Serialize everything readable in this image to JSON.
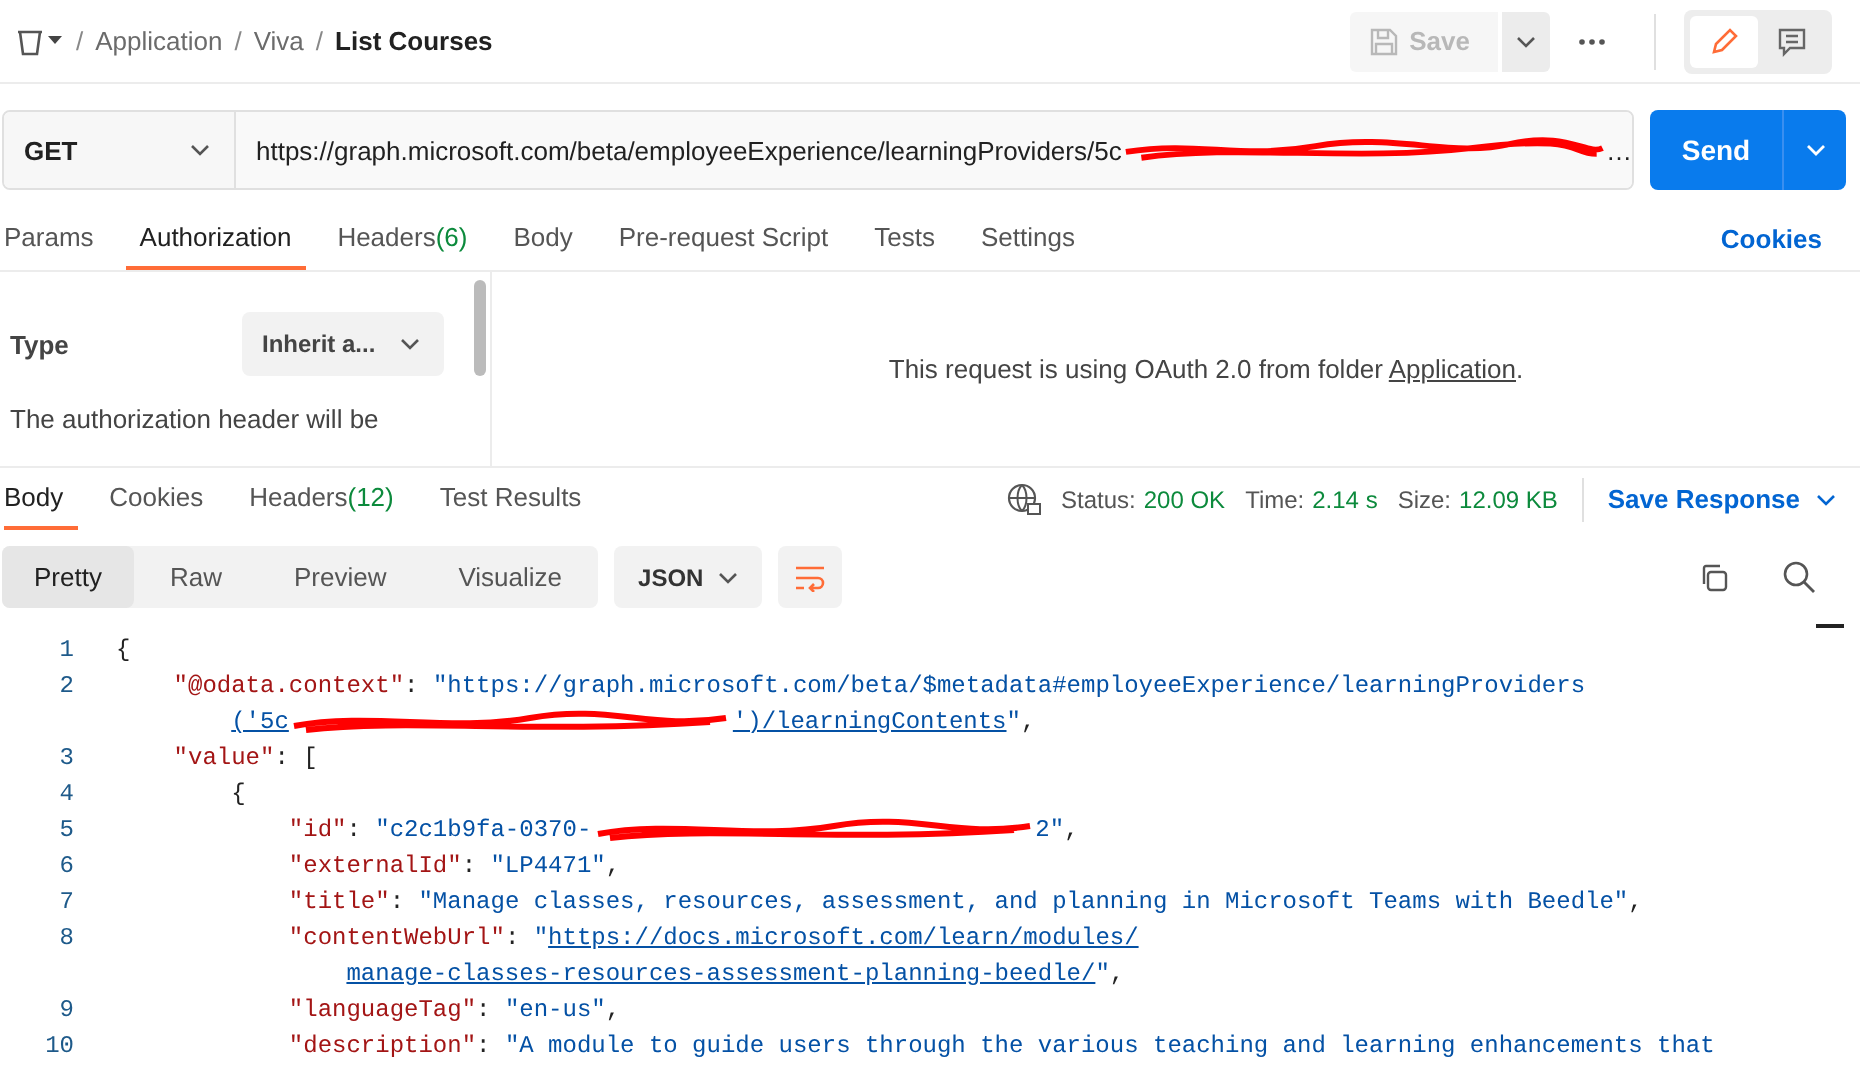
{
  "header": {
    "path": [
      {
        "separator": "/",
        "label": "Application"
      },
      {
        "separator": "/",
        "label": "Viva"
      }
    ],
    "title_separator": "/",
    "title": "List Courses",
    "save_button": {
      "label": "Save",
      "disabled": true
    }
  },
  "request": {
    "method": "GET",
    "url": "https://graph.microsoft.com/beta/employeeExperience/learningProviders/5c",
    "url_tail": "…",
    "send": "Send"
  },
  "request_tabs": [
    {
      "label": "Params",
      "selected": false
    },
    {
      "label": "Authorization",
      "selected": true
    },
    {
      "label": "Headers",
      "count": "(6)",
      "selected": false
    },
    {
      "label": "Body",
      "selected": false
    },
    {
      "label": "Pre-request Script",
      "selected": false
    },
    {
      "label": "Tests",
      "selected": false
    },
    {
      "label": "Settings",
      "selected": false
    }
  ],
  "cookies_link": "Cookies",
  "auth": {
    "type_label": "Type",
    "type_value": "Inherit a...",
    "description": "The authorization header will be",
    "message_before": "This request is using OAuth 2.0 from folder ",
    "message_link": "Application",
    "message_after": "."
  },
  "response_tabs": [
    {
      "label": "Body",
      "selected": true
    },
    {
      "label": "Cookies",
      "selected": false
    },
    {
      "label": "Headers",
      "count": "(12)",
      "selected": false
    },
    {
      "label": "Test Results",
      "selected": false
    }
  ],
  "status": [
    {
      "label": "Status:",
      "value": "200 OK"
    },
    {
      "label": "Time:",
      "value": "2.14 s"
    },
    {
      "label": "Size:",
      "value": "12.09 KB"
    }
  ],
  "save_response": "Save Response",
  "view_tabs": [
    {
      "label": "Pretty",
      "selected": true
    },
    {
      "label": "Raw",
      "selected": false
    },
    {
      "label": "Preview",
      "selected": false
    },
    {
      "label": "Visualize",
      "selected": false
    }
  ],
  "format": "JSON",
  "code": [
    {
      "number": "1",
      "parts": [
        {
          "kind": "punct",
          "text": "{"
        }
      ]
    },
    {
      "number": "2",
      "parts": [
        {
          "kind": "key",
          "text": "    \"@odata.context\""
        },
        {
          "kind": "punct",
          "text": ": "
        },
        {
          "kind": "string",
          "text": "\"https://graph.microsoft.com/beta/$metadata#employeeExperience/learningProviders"
        }
      ]
    },
    {
      "parts": [
        {
          "kind": "link",
          "text": "('5c"
        },
        {
          "kind": "redacted"
        },
        {
          "kind": "link",
          "text": "')/learningContents"
        },
        {
          "kind": "string",
          "text": "\""
        },
        {
          "kind": "punct",
          "text": ","
        }
      ]
    },
    {
      "number": "3",
      "parts": [
        {
          "kind": "key",
          "text": "    \"value\""
        },
        {
          "kind": "punct",
          "text": ": ["
        }
      ]
    },
    {
      "number": "4",
      "parts": [
        {
          "kind": "punct",
          "text": "        {"
        }
      ]
    },
    {
      "number": "5",
      "parts": [
        {
          "kind": "key",
          "text": "            \"id\""
        },
        {
          "kind": "punct",
          "text": ": "
        },
        {
          "kind": "string",
          "text": "\"c2c1b9fa-0370-"
        },
        {
          "kind": "redacted"
        },
        {
          "kind": "string",
          "text": "2\""
        },
        {
          "kind": "punct",
          "text": ","
        }
      ]
    },
    {
      "number": "6",
      "parts": [
        {
          "kind": "key",
          "text": "            \"externalId\""
        },
        {
          "kind": "punct",
          "text": ": "
        },
        {
          "kind": "string",
          "text": "\"LP4471\""
        },
        {
          "kind": "punct",
          "text": ","
        }
      ]
    },
    {
      "number": "7",
      "parts": [
        {
          "kind": "key",
          "text": "            \"title\""
        },
        {
          "kind": "punct",
          "text": ": "
        },
        {
          "kind": "string",
          "text": "\"Manage classes, resources, assessment, and planning in Microsoft Teams with Beedle\""
        },
        {
          "kind": "punct",
          "text": ","
        }
      ]
    },
    {
      "number": "8",
      "parts": [
        {
          "kind": "key",
          "text": "            \"contentWebUrl\""
        },
        {
          "kind": "punct",
          "text": ": "
        },
        {
          "kind": "string",
          "text": "\""
        },
        {
          "kind": "link",
          "text": "https://docs.microsoft.com/learn/modules/"
        }
      ]
    },
    {
      "parts": [
        {
          "kind": "link",
          "text": "manage-classes-resources-assessment-planning-beedle/"
        },
        {
          "kind": "string",
          "text": "\""
        },
        {
          "kind": "punct",
          "text": ","
        }
      ]
    },
    {
      "number": "9",
      "parts": [
        {
          "kind": "key",
          "text": "            \"languageTag\""
        },
        {
          "kind": "punct",
          "text": ": "
        },
        {
          "kind": "string",
          "text": "\"en-us\""
        },
        {
          "kind": "punct",
          "text": ","
        }
      ]
    },
    {
      "number": "10",
      "parts": [
        {
          "kind": "key",
          "text": "            \"description\""
        },
        {
          "kind": "punct",
          "text": ": "
        },
        {
          "kind": "string",
          "text": "\"A module to guide users through the various teaching and learning enhancements that"
        }
      ]
    }
  ]
}
